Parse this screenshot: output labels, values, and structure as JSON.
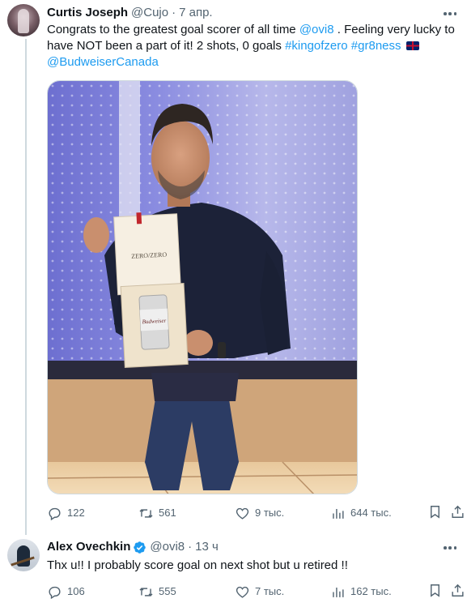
{
  "tweets": [
    {
      "display_name": "Curtis Joseph",
      "handle": "@Cujo",
      "separator": "·",
      "time": "7 апр.",
      "text": {
        "p1": "Congrats to the greatest goal scorer of all time ",
        "mention1": "@ovi8",
        "p2": " . Feeling very lucky to have NOT been a part of it! 2 shots, 0 goals ",
        "hashtag1": "#kingofzero",
        "hashtag2": "#gr8ness",
        "mention2": "@BudweiserCanada"
      },
      "photo": {
        "box_brand": "ZERO/ZERO",
        "can_label": "Budweiser"
      },
      "metrics": {
        "replies": "122",
        "retweets": "561",
        "likes": "9 тыс.",
        "views": "644 тыс."
      }
    },
    {
      "display_name": "Alex Ovechkin",
      "handle": "@ovi8",
      "separator": "·",
      "time": "13 ч",
      "verified": true,
      "text": "Thx u!! I probably score goal on next shot but u retired !!",
      "metrics": {
        "replies": "106",
        "retweets": "555",
        "likes": "7 тыс.",
        "views": "162 тыс."
      }
    }
  ],
  "colors": {
    "text": "#0f1419",
    "secondary": "#536471",
    "link": "#1d9bf0",
    "verified": "#1d9bf0",
    "thread_line": "#cfd9de"
  },
  "icons": [
    "reply-icon",
    "retweet-icon",
    "like-icon",
    "views-icon",
    "bookmark-icon",
    "share-icon",
    "more-icon",
    "verified-badge-icon",
    "uk-flag-emoji"
  ]
}
